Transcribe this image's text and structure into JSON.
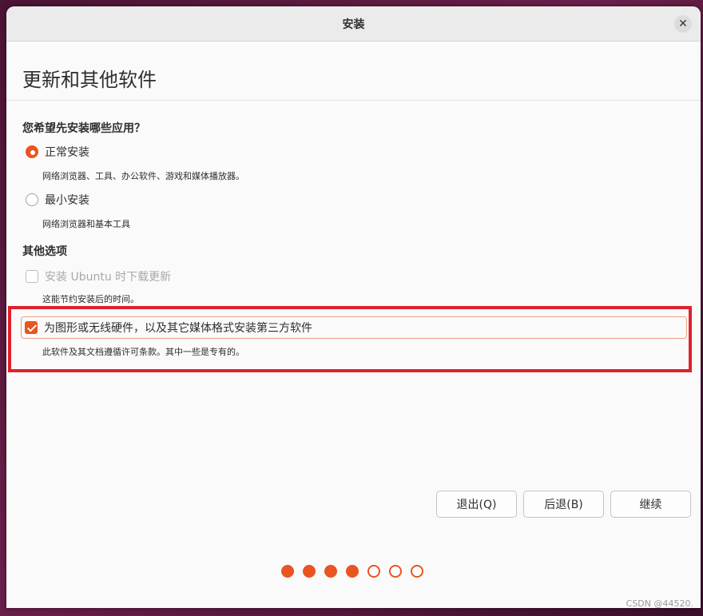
{
  "window": {
    "title": "安装"
  },
  "page_title": "更新和其他软件",
  "install_question": "您希望先安装哪些应用？",
  "options": [
    {
      "label": "正常安装",
      "desc": "网络浏览器、工具、办公软件、游戏和媒体播放器。",
      "selected": true
    },
    {
      "label": "最小安装",
      "desc": "网络浏览器和基本工具",
      "selected": false
    }
  ],
  "other_section": "其他选项",
  "checkboxes": [
    {
      "label": "安装 Ubuntu 时下载更新",
      "desc": "这能节约安装后的时间。",
      "checked": false,
      "disabled": true
    },
    {
      "label": "为图形或无线硬件，以及其它媒体格式安装第三方软件",
      "desc": "此软件及其文档遵循许可条款。其中一些是专有的。",
      "checked": true,
      "disabled": false
    }
  ],
  "buttons": {
    "quit": "退出(Q)",
    "back": "后退(B)",
    "continue": "继续"
  },
  "progress": {
    "completed_steps": 4,
    "total_steps": 7
  },
  "watermark": "CSDN @44520.",
  "colors": {
    "accent": "#e95420",
    "highlight_border": "#e0212a"
  }
}
